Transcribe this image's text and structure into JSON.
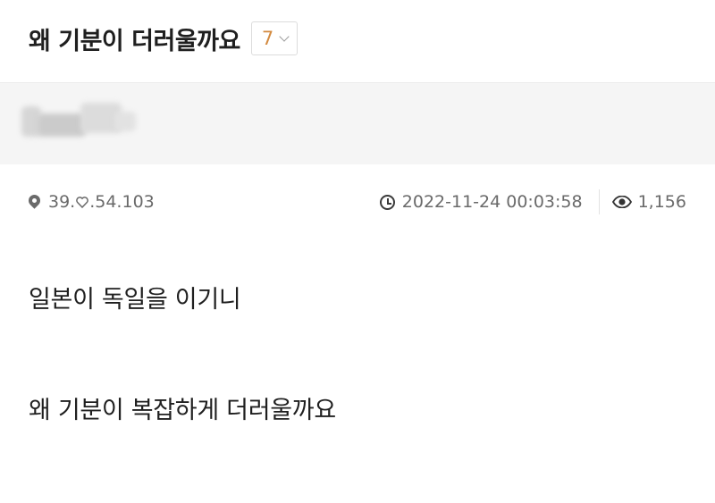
{
  "post": {
    "title": "왜 기분이 더러울까요",
    "comment_count": "7"
  },
  "meta": {
    "location": "39.",
    "ip_suffix": ".54.103",
    "datetime": "2022-11-24 00:03:58",
    "views": "1,156"
  },
  "content": {
    "lines": [
      "일본이 독일을 이기니",
      "왜 기분이 복잡하게 더러울까요"
    ]
  },
  "colors": {
    "comment_count": "#d38a3f",
    "author_band": "#f5f5f5",
    "meta_text": "#6a6a6a"
  }
}
